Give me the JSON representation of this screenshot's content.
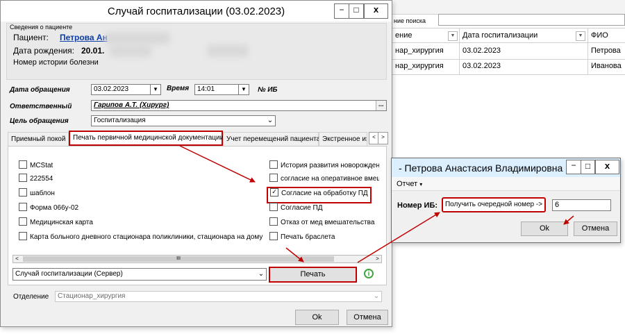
{
  "colors": {
    "accent_red": "#c00000",
    "link_blue": "#0b3ba6",
    "ok_icon_green": "#3fa63f"
  },
  "bg_window": {
    "search_label": "ние поиска",
    "columns": [
      "ение",
      "Дата госпитализации",
      "ФИО"
    ],
    "rows": [
      {
        "c1": "нар_хирургия",
        "c2": "03.02.2023",
        "c3": "Петрова"
      },
      {
        "c1": "нар_хирургия",
        "c2": "03.02.2023",
        "c3": "Иванова"
      }
    ]
  },
  "main_dialog": {
    "title": "Случай госпитализации (03.02.2023)",
    "window_buttons": {
      "minimize": "−",
      "maximize": "□",
      "close": "x"
    },
    "patient_info": {
      "legend": "Сведения о пациенте",
      "patient_label": "Пациент:",
      "patient_name": "Петрова Ан",
      "dob_label": "Дата рождения:",
      "dob_value": "20.01.",
      "history_label": "Номер истории болезни"
    },
    "form": {
      "date_label": "Дата обращения",
      "date_value": "03.02.2023",
      "time_label": "Время",
      "time_value": "14:01",
      "ib_label": "№ ИБ",
      "responsible_label": "Ответственный",
      "responsible_value": "Гарипов А.Т. (Хирург)",
      "purpose_label": "Цель обращения",
      "purpose_value": "Госпитализация"
    },
    "tabs": [
      "Приемный покой",
      "Печать первичной медицинской документации",
      "Учет перемещений пациента",
      "Экстренное из"
    ],
    "checkboxes_left": [
      {
        "label": "MCStat",
        "checked": false
      },
      {
        "label": "222554",
        "checked": false
      },
      {
        "label": "шаблон",
        "checked": false
      },
      {
        "label": "Форма 066у-02",
        "checked": false
      },
      {
        "label": "Медицинская карта",
        "checked": false
      },
      {
        "label": "Карта больного дневного стационара поликлиники, стационара на дому",
        "checked": false
      }
    ],
    "checkboxes_right": [
      {
        "label": "История развития новорожден",
        "checked": false
      },
      {
        "label": "согласие на оперативное вмеш",
        "checked": false
      },
      {
        "label": "Согласие на обработку ПД",
        "checked": true
      },
      {
        "label": "Согласие ПД",
        "checked": false
      },
      {
        "label": "Отказ от мед вмешательства",
        "checked": false
      },
      {
        "label": "Печать браслета",
        "checked": false
      }
    ],
    "scrollbar_thumb": "III",
    "print_source": "Случай госпитализации (Сервер)",
    "print_button": "Печать",
    "department_label": "Отделение",
    "department_value": "Стационар_хирургия",
    "ok_button": "Ok",
    "cancel_button": "Отмена"
  },
  "ib_dialog": {
    "title": "- Петрова Анастасия Владимировна",
    "menu_report": "Отчет",
    "ib_label": "Номер ИБ:",
    "get_next_button": "Получить очередной номер ->",
    "ib_value": "6",
    "ok_button": "Ok",
    "cancel_button": "Отмена"
  }
}
